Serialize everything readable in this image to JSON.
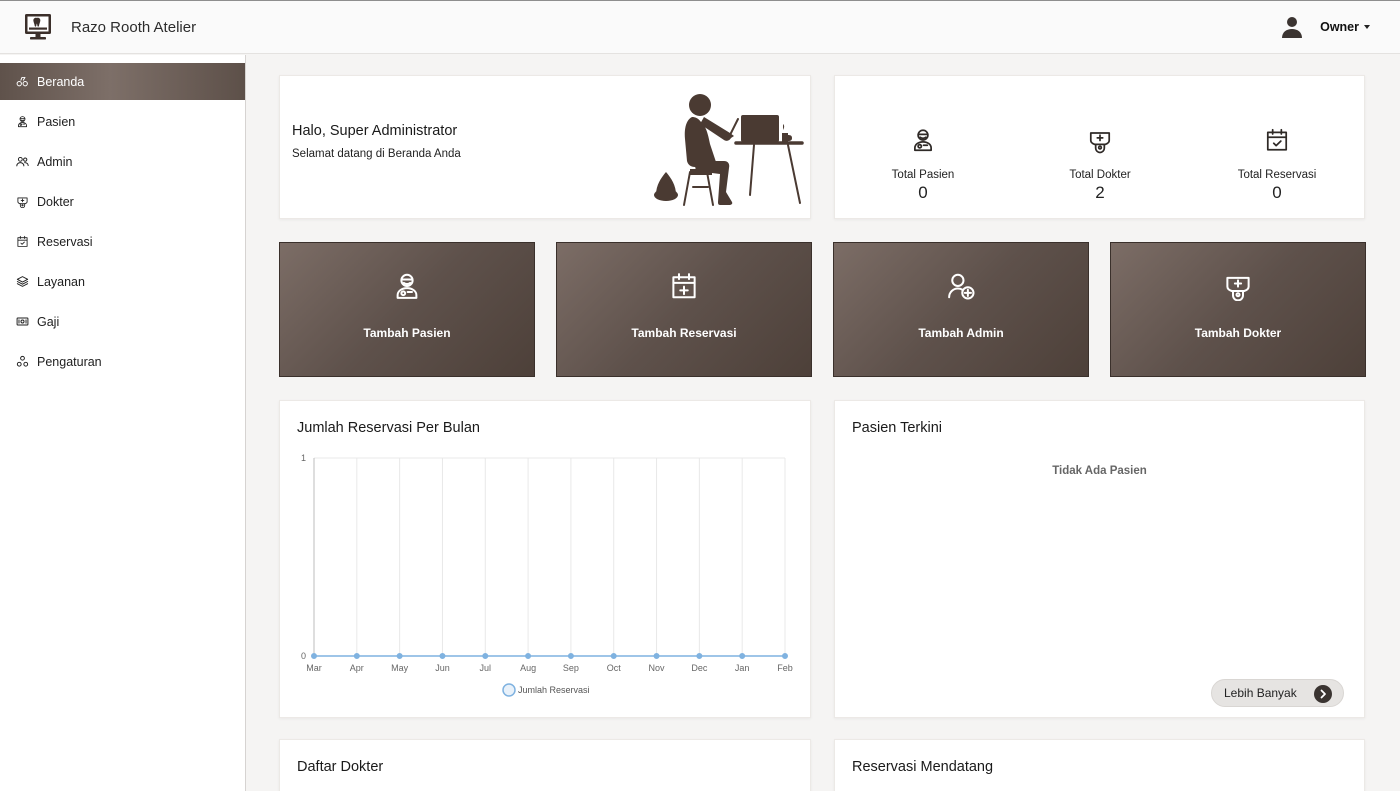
{
  "app": {
    "name": "Razo Rooth Atelier",
    "logo_icon": "dental-monitor-logo-icon"
  },
  "user": {
    "name": "Owner",
    "icon": "user-icon"
  },
  "colors": {
    "accent": "#6d5f58",
    "chart_line": "#7fb2e0",
    "page_bg": "#f5f4f3"
  },
  "sidebar": {
    "items": [
      {
        "label": "Beranda",
        "icon": "home-icon",
        "active": true
      },
      {
        "label": "Pasien",
        "icon": "patient-icon"
      },
      {
        "label": "Admin",
        "icon": "admin-icon"
      },
      {
        "label": "Dokter",
        "icon": "doctor-icon"
      },
      {
        "label": "Reservasi",
        "icon": "calendar-icon"
      },
      {
        "label": "Layanan",
        "icon": "layers-icon"
      },
      {
        "label": "Gaji",
        "icon": "salary-icon"
      },
      {
        "label": "Pengaturan",
        "icon": "settings-icon"
      }
    ]
  },
  "welcome": {
    "title": "Halo, Super Administrator",
    "subtitle": "Selamat datang di Beranda Anda"
  },
  "stats": [
    {
      "label": "Total Pasien",
      "value": "0",
      "icon": "patient-icon"
    },
    {
      "label": "Total Dokter",
      "value": "2",
      "icon": "doctor-icon"
    },
    {
      "label": "Total Reservasi",
      "value": "0",
      "icon": "calendar-check-icon"
    }
  ],
  "actions": [
    {
      "label": "Tambah Pasien",
      "icon": "patient-icon"
    },
    {
      "label": "Tambah Reservasi",
      "icon": "calendar-plus-icon"
    },
    {
      "label": "Tambah Admin",
      "icon": "user-plus-icon"
    },
    {
      "label": "Tambah Dokter",
      "icon": "doctor-icon"
    }
  ],
  "reservations_chart": {
    "title": "Jumlah Reservasi Per Bulan"
  },
  "chart_data": {
    "type": "line",
    "title": "Jumlah Reservasi Per Bulan",
    "x": [
      "Mar",
      "Apr",
      "May",
      "Jun",
      "Jul",
      "Aug",
      "Sep",
      "Oct",
      "Nov",
      "Dec",
      "Jan",
      "Feb"
    ],
    "series": [
      {
        "name": "Jumlah Reservasi",
        "values": [
          0,
          0,
          0,
          0,
          0,
          0,
          0,
          0,
          0,
          0,
          0,
          0
        ]
      }
    ],
    "yticks": [
      "0",
      "1"
    ],
    "ylim": [
      0,
      1
    ],
    "grid": true,
    "legend": "bottom"
  },
  "recent_patients": {
    "title": "Pasien Terkini",
    "empty_text": "Tidak Ada Pasien",
    "more_label": "Lebih Banyak"
  },
  "doctors_panel": {
    "title": "Daftar Dokter"
  },
  "upcoming_panel": {
    "title": "Reservasi Mendatang"
  }
}
